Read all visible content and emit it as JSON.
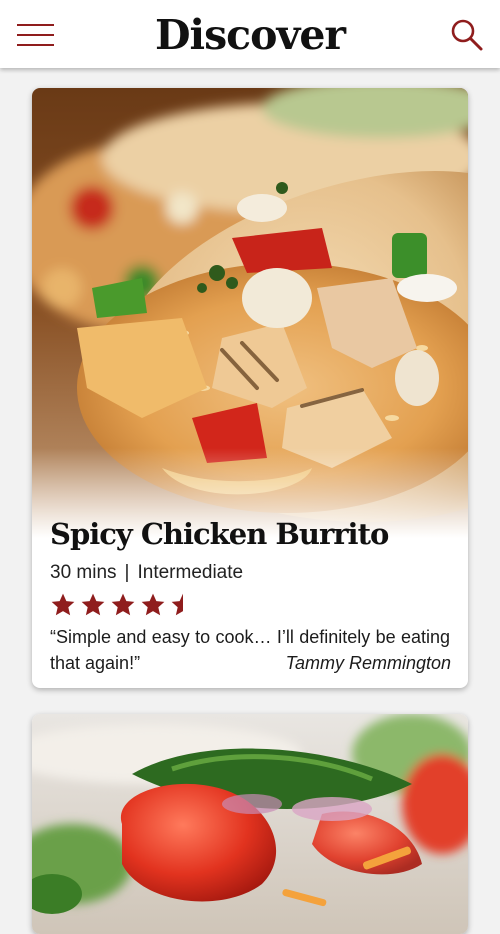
{
  "header": {
    "title": "Discover",
    "menu_icon": "hamburger-menu-icon",
    "search_icon": "search-icon",
    "accent_color": "#8f1d1d"
  },
  "recipes": [
    {
      "name": "Spicy Chicken Burrito",
      "time": "30 mins",
      "separator": "|",
      "difficulty": "Intermediate",
      "rating": 4.5,
      "rating_max": 5,
      "quote": "“Simple and easy to cook… I’ll definitely be eating that again!”",
      "author": "Tammy Remmington"
    },
    {
      "name": "",
      "time": "",
      "difficulty": ""
    }
  ]
}
